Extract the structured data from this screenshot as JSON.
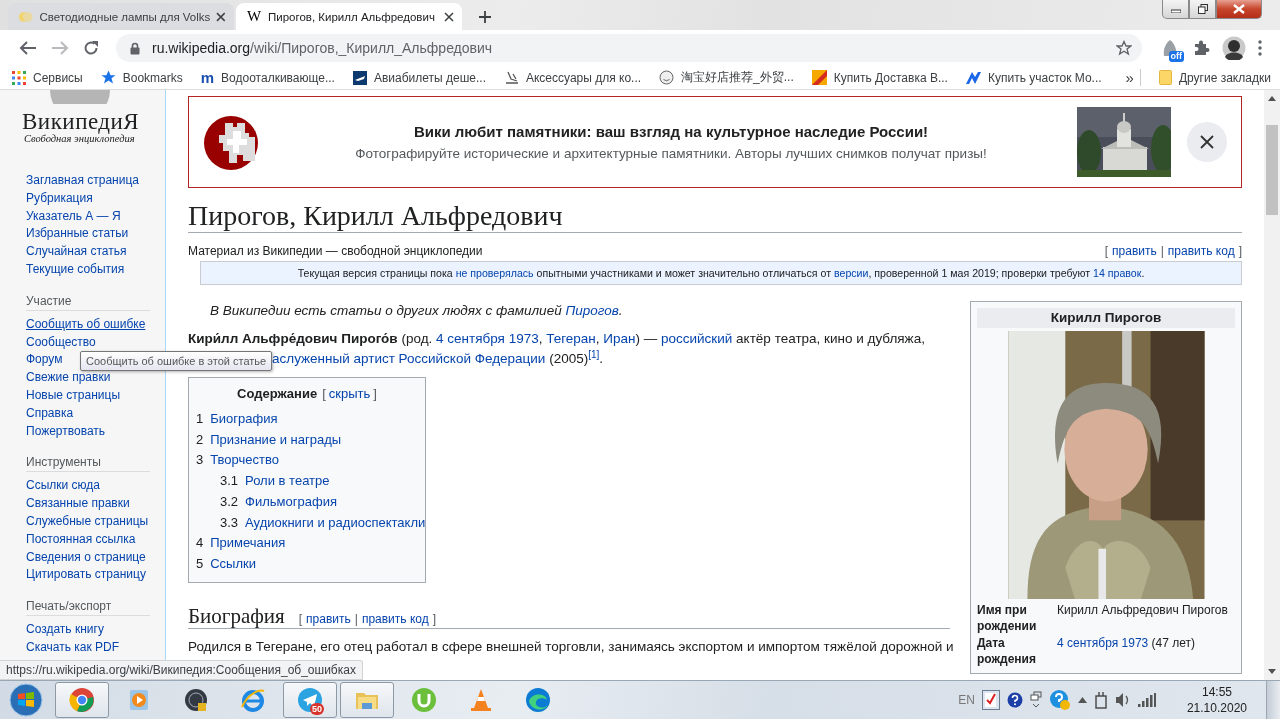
{
  "browser": {
    "tabs": [
      {
        "title": "Светодиодные лампы для Volks",
        "selected": false,
        "kind": "bulb"
      },
      {
        "title": "Пирогов, Кирилл Альфредович",
        "selected": true,
        "kind": "letter",
        "favicon": "W"
      }
    ],
    "nav": {
      "back_disabled": false,
      "forward_disabled": true
    },
    "address": {
      "host": "ru.wikipedia.org",
      "path": "/wiki/Пирогов,_Кирилл_Альфредович"
    },
    "extension_badge": "off",
    "bookmarks": [
      {
        "label": "Сервисы",
        "kind": "apps"
      },
      {
        "label": "Bookmarks",
        "kind": "star"
      },
      {
        "label": "Водооталкивающе...",
        "kind": "letter",
        "icon_text": "m"
      },
      {
        "label": "Авиабилеты деше...",
        "kind": "plane"
      },
      {
        "label": "Аксессуары для ко...",
        "kind": "skate"
      },
      {
        "label": "淘宝好店推荐_外贸...",
        "kind": "smile"
      },
      {
        "label": "Купить Доставка В...",
        "kind": "flag"
      },
      {
        "label": "Купить участок Мо...",
        "kind": "chevron"
      }
    ],
    "bookmarks_more": "»",
    "other_bookmarks": "Другие закладки"
  },
  "sidebar": {
    "logo_title": "ВикипедиЯ",
    "logo_subtitle": "Свободная энциклопедия",
    "sections": [
      {
        "links": [
          {
            "label": "Заглавная страница",
            "hovered": false
          },
          {
            "label": "Рубрикация",
            "hovered": false
          },
          {
            "label": "Указатель А — Я",
            "hovered": false
          },
          {
            "label": "Избранные статьи",
            "hovered": false
          },
          {
            "label": "Случайная статья",
            "hovered": false
          },
          {
            "label": "Текущие события",
            "hovered": false
          }
        ]
      },
      {
        "heading": "Участие",
        "links": [
          {
            "label": "Сообщить об ошибке",
            "hovered": true
          },
          {
            "label": "Сообщество",
            "hovered": false
          },
          {
            "label": "Форум",
            "hovered": false
          },
          {
            "label": "Свежие правки",
            "hovered": false
          },
          {
            "label": "Новые страницы",
            "hovered": false
          },
          {
            "label": "Справка",
            "hovered": false
          },
          {
            "label": "Пожертвовать",
            "hovered": false
          }
        ]
      },
      {
        "heading": "Инструменты",
        "links": [
          {
            "label": "Ссылки сюда",
            "hovered": false
          },
          {
            "label": "Связанные правки",
            "hovered": false
          },
          {
            "label": "Служебные страницы",
            "hovered": false
          },
          {
            "label": "Постоянная ссылка",
            "hovered": false
          },
          {
            "label": "Сведения о странице",
            "hovered": false
          },
          {
            "label": "Цитировать страницу",
            "hovered": false
          }
        ]
      },
      {
        "heading": "Печать/экспорт",
        "links": [
          {
            "label": "Создать книгу",
            "hovered": false
          },
          {
            "label": "Скачать как PDF",
            "hovered": false
          }
        ]
      }
    ]
  },
  "tooltip": "Сообщить об ошибке в этой статье",
  "article": {
    "banner": {
      "title": "Вики любит памятники: ваш взгляд на культурное наследие России!",
      "text": "Фотографируйте исторические и архитектурные памятники. Авторы лучших снимков получат призы!"
    },
    "title": "Пирогов, Кирилл Альфредович",
    "tagline": "Материал из Википедии — свободной энциклопедии",
    "edit_links": {
      "open": "[",
      "items": [
        "править",
        "править код"
      ],
      "separator": "|",
      "close": "]"
    },
    "notice": [
      {
        "kind": "text",
        "text": "Текущая версия страницы пока "
      },
      {
        "kind": "link",
        "text": "не проверялась"
      },
      {
        "kind": "text",
        "text": " опытными участниками и может значительно отличаться от "
      },
      {
        "kind": "link",
        "text": "версии"
      },
      {
        "kind": "text",
        "text": ", проверенной 1 мая 2019; проверки требуют "
      },
      {
        "kind": "link",
        "text": "14 правок"
      },
      {
        "kind": "text",
        "text": "."
      }
    ],
    "hatnote": [
      {
        "kind": "text",
        "text": "В Википедии есть статьи о других людях с фамилией "
      },
      {
        "kind": "link",
        "text": "Пирогов"
      },
      {
        "kind": "text",
        "text": "."
      }
    ],
    "lead_lines": [
      [
        {
          "kind": "bold",
          "text": "Кири́лл Альфре́дович Пирого́в"
        },
        {
          "kind": "text",
          "text": " (род. "
        },
        {
          "kind": "link",
          "text": "4 сентября 1973"
        },
        {
          "kind": "text",
          "text": ", "
        },
        {
          "kind": "link",
          "text": "Тегеран"
        },
        {
          "kind": "text",
          "text": ", "
        },
        {
          "kind": "link",
          "text": "Иран"
        },
        {
          "kind": "text",
          "text": ") — "
        },
        {
          "kind": "link",
          "text": "российский"
        },
        {
          "kind": "text",
          "text": " актёр театра, кино и дубляжа,"
        }
      ],
      [
        {
          "kind": "link",
          "text": "аслуженный артист Российской Федерации"
        },
        {
          "kind": "text",
          "text": " (2005)"
        },
        {
          "kind": "ref",
          "text": "[1]"
        },
        {
          "kind": "text",
          "text": "."
        }
      ]
    ],
    "toc": {
      "title": "Содержание",
      "toggle": {
        "open": "[",
        "label": "скрыть",
        "close": "]"
      },
      "items": [
        {
          "number": "1",
          "label": "Биография"
        },
        {
          "number": "2",
          "label": "Признание и награды"
        },
        {
          "number": "3",
          "label": "Творчество",
          "children": [
            {
              "number": "3.1",
              "label": "Роли в театре"
            },
            {
              "number": "3.2",
              "label": "Фильмография"
            },
            {
              "number": "3.3",
              "label": "Аудиокниги и радиоспектакли"
            }
          ]
        },
        {
          "number": "4",
          "label": "Примечания"
        },
        {
          "number": "5",
          "label": "Ссылки"
        }
      ]
    },
    "section": {
      "heading": "Биография",
      "edit_links": {
        "open": "[",
        "items": [
          "править",
          "править код"
        ],
        "separator": "|",
        "close": "]"
      },
      "text": "Родился в Тегеране, его отец работал в сфере внешней торговли, занимаясь экспортом и импортом тяжёлой дорожной и"
    },
    "infobox": {
      "title": "Кирилл Пирогов",
      "rows": [
        {
          "label": "Имя при рождении",
          "value": [
            {
              "kind": "text",
              "text": "Кирилл Альфредович Пирогов"
            }
          ]
        },
        {
          "label": "Дата рождения",
          "value": [
            {
              "kind": "link",
              "text": "4 сентября 1973"
            },
            {
              "kind": "text",
              "text": " (47 лет)"
            }
          ]
        }
      ]
    }
  },
  "status_url": "https://ru.wikipedia.org/wiki/Википедия:Сообщения_об_ошибках",
  "taskbar": {
    "apps": [
      {
        "kind": "browser",
        "running": true
      },
      {
        "kind": "media",
        "running": false
      },
      {
        "kind": "disc",
        "running": false
      },
      {
        "kind": "ie",
        "running": false
      },
      {
        "kind": "messenger",
        "running": true,
        "badge": "50"
      },
      {
        "kind": "folder",
        "running": true
      },
      {
        "kind": "torrent",
        "running": false
      },
      {
        "kind": "cone",
        "running": false
      },
      {
        "kind": "swirl",
        "running": false
      }
    ],
    "tray": {
      "language": "EN",
      "time": "14:55",
      "date": "21.10.2020"
    }
  }
}
